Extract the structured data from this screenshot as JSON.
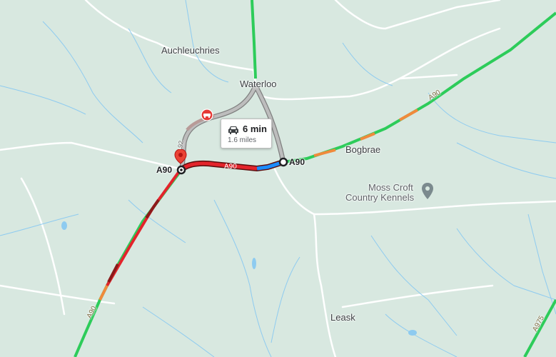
{
  "map": {
    "places": {
      "auchleuchries": "Auchleuchries",
      "waterloo": "Waterloo",
      "bogbrae": "Bogbrae",
      "leask": "Leask",
      "moss_croft_line1": "Moss Croft",
      "moss_croft_line2": "Country Kennels"
    },
    "roads": {
      "a90_start": "A90",
      "a90_end": "A90",
      "a90_route": "A90",
      "a90_ne": "A90",
      "a90_sw": "A90",
      "a975": "A975",
      "road_b92": "92"
    },
    "route": {
      "duration": "6 min",
      "distance": "1.6 miles"
    },
    "icons": {
      "start_pin": "red-location-pin-icon",
      "poi_pin": "grey-location-pin-icon",
      "incident": "road-incident-icon",
      "vehicle": "car-icon"
    },
    "colors": {
      "land": "#d8e8e0",
      "traffic_heavy": "#e3242b",
      "traffic_severe": "#8b1a1a",
      "traffic_moderate": "#f08a3c",
      "traffic_free": "#2dcc5a",
      "route_blue": "#1a8cff",
      "alternate_route": "#9e9e9e"
    }
  }
}
